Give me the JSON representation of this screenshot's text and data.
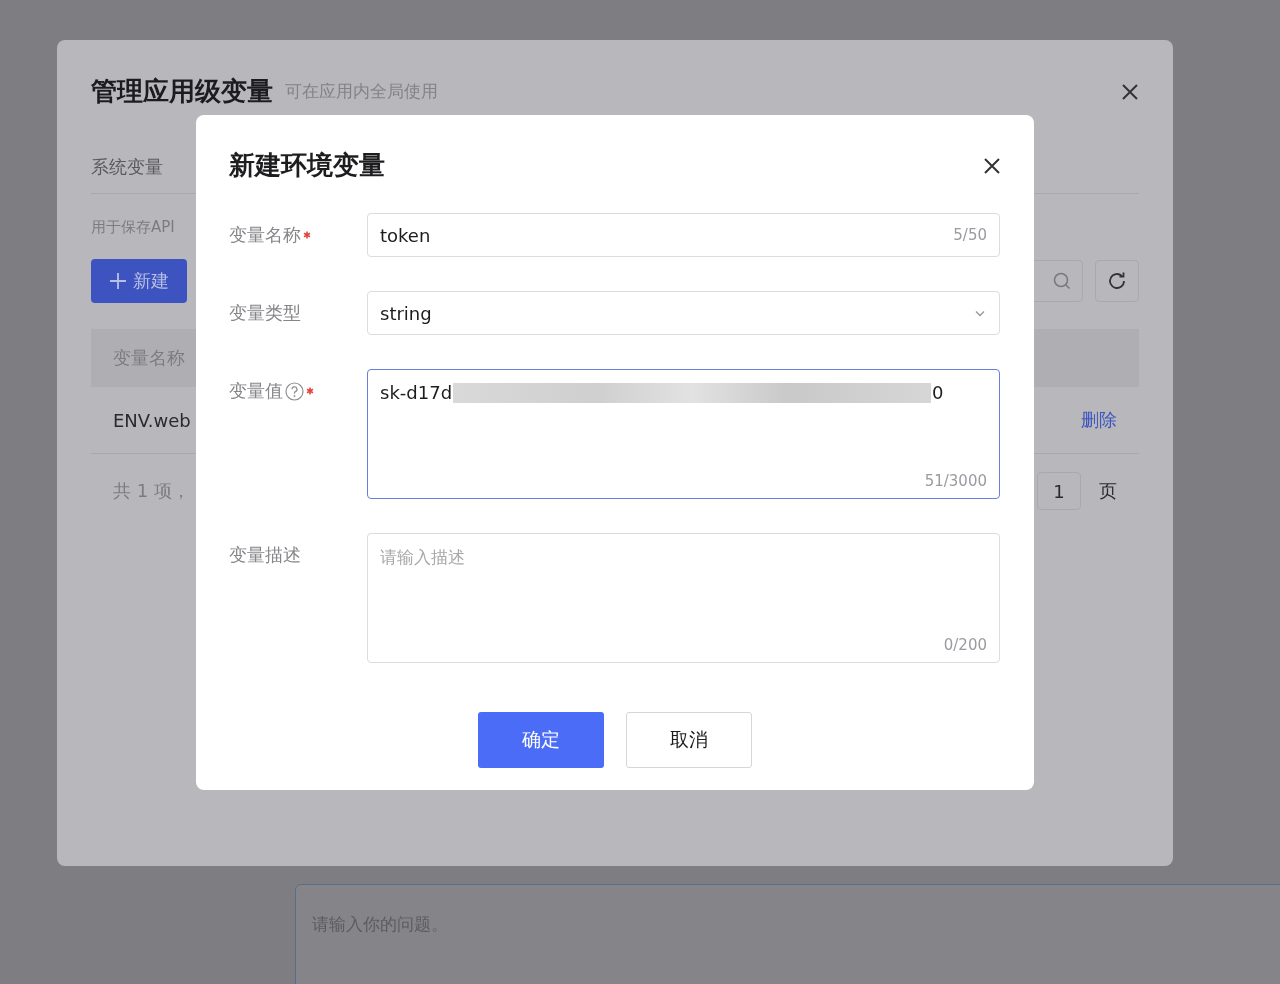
{
  "outer_dialog": {
    "title": "管理应用级变量",
    "subtitle": "可在应用内全局使用",
    "tabs": [
      "系统变量"
    ],
    "description": "用于保存API",
    "new_button": "新建",
    "table": {
      "columns": [
        "变量名称"
      ],
      "rows": [
        {
          "cells": [
            "ENV.web"
          ],
          "actions": [
            "删除"
          ]
        }
      ]
    },
    "pagination": {
      "total": "共 1 项，",
      "page": "1",
      "page_unit": "页"
    }
  },
  "dialog": {
    "title": "新建环境变量",
    "fields": [
      {
        "kind": "input",
        "label": "变量名称",
        "required": true,
        "help": false,
        "value": "token",
        "counter": "5/50"
      },
      {
        "kind": "select",
        "label": "变量类型",
        "required": false,
        "help": false,
        "value": "string"
      },
      {
        "kind": "textarea",
        "label": "变量值",
        "required": true,
        "help": true,
        "value": "sk-d17d",
        "value_tail": "0",
        "redacted": true,
        "focused": true,
        "counter": "51/3000"
      },
      {
        "kind": "textarea",
        "label": "变量描述",
        "required": false,
        "help": false,
        "placeholder": "请输入描述",
        "focused": false,
        "counter": "0/200"
      }
    ],
    "buttons": [
      {
        "label": "确定",
        "primary": true
      },
      {
        "label": "取消",
        "primary": false
      }
    ]
  },
  "chat_input": {
    "placeholder": "请输入你的问题。"
  }
}
